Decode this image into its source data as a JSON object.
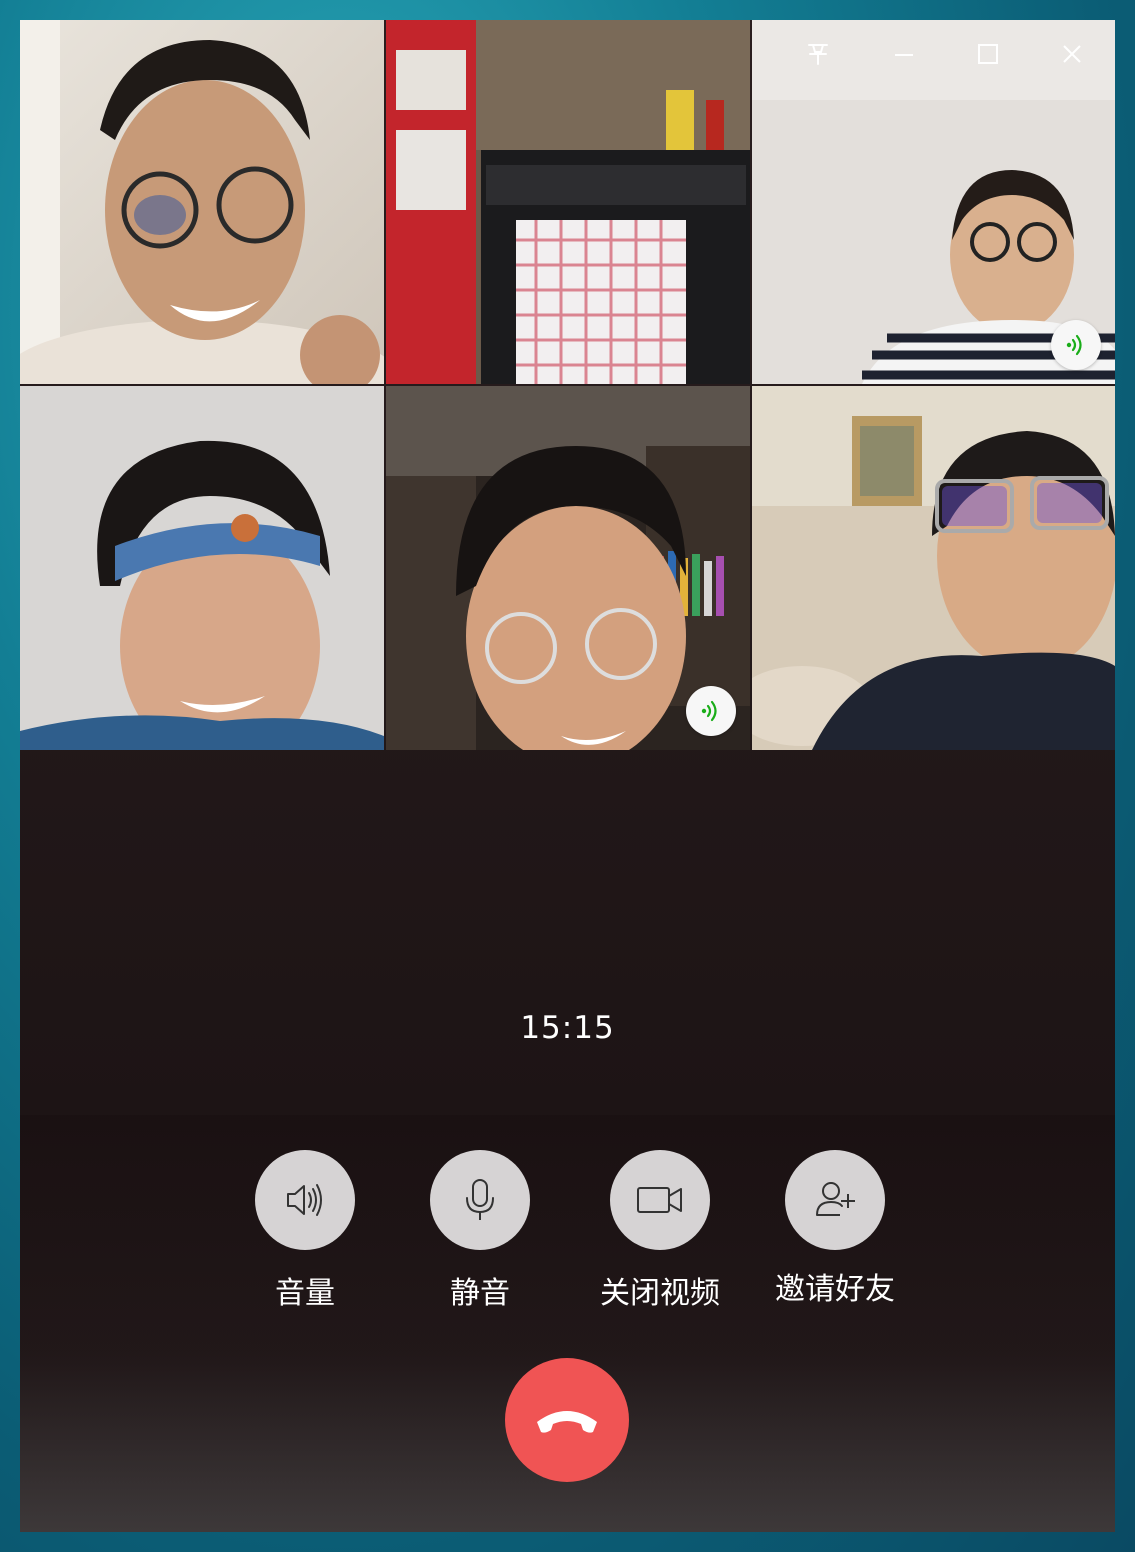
{
  "window": {
    "controls": {
      "pin": "pin-icon",
      "minimize": "minimize-icon",
      "maximize": "maximize-icon",
      "close": "close-icon"
    }
  },
  "participants": [
    {
      "slot": "top-left",
      "speaking": false
    },
    {
      "slot": "top-middle",
      "speaking": false
    },
    {
      "slot": "top-right",
      "speaking": true
    },
    {
      "slot": "bottom-left",
      "speaking": false
    },
    {
      "slot": "bottom-middle",
      "speaking": true
    },
    {
      "slot": "bottom-right",
      "speaking": false
    }
  ],
  "call": {
    "duration": "15:15"
  },
  "controls": [
    {
      "id": "volume",
      "label": "音量",
      "icon": "speaker-icon"
    },
    {
      "id": "mute",
      "label": "静音",
      "icon": "microphone-icon"
    },
    {
      "id": "video",
      "label": "关闭视频",
      "icon": "video-camera-icon"
    },
    {
      "id": "invite",
      "label": "邀请好友",
      "icon": "add-user-icon"
    }
  ],
  "hangup": {
    "icon": "hang-up-icon"
  },
  "colors": {
    "hangup": "#f05454",
    "control_circle": "#d6d3d4",
    "speaking_indicator": "#1aad19",
    "panel_bg": "#221819"
  }
}
